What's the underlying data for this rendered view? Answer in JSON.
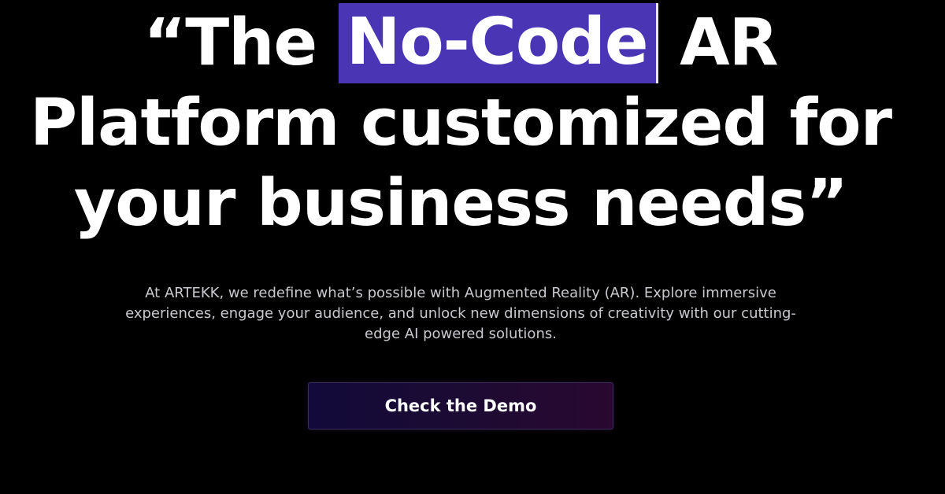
{
  "hero": {
    "headline": {
      "open_quote": "“The ",
      "highlight": "No-Code",
      "after_highlight": " AR",
      "line2": "Platform customized for",
      "line3": "your business needs”"
    },
    "description": "At ARTEKK, we redefine what’s possible with Augmented Reality (AR). Explore immersive experiences, engage your audience, and unlock new dimensions of creativity with our cutting-edge AI powered solutions.",
    "cta_label": "Check the Demo"
  },
  "colors": {
    "background": "#000000",
    "highlight": "#4a35b5",
    "text": "#ffffff",
    "subtext": "#c9c9cf",
    "button_gradient_start": "#120a3a",
    "button_gradient_end": "#2a0830"
  }
}
